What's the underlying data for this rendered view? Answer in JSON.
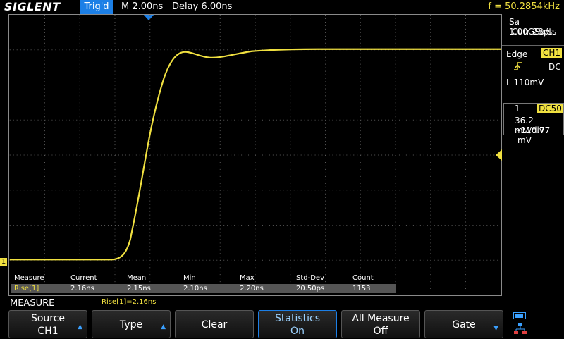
{
  "header": {
    "brand": "SIGLENT",
    "trigger_status": "Trig'd",
    "timebase": "M 2.00ns",
    "delay": "Delay 6.00ns",
    "frequency": "f = 50.2854kHz"
  },
  "acquisition": {
    "sample_rate": "Sa 1.00GSa/s",
    "current_points": "Curr 28pts"
  },
  "trigger": {
    "type": "Edge",
    "source": "CH1",
    "coupling": "DC",
    "level": "L  110mV"
  },
  "channel": {
    "number": "1",
    "coupling_badge": "DC50",
    "scale": "36.2 mV/div",
    "offset": "-110.77 mV",
    "marker": "1"
  },
  "measure": {
    "headers": [
      "Measure",
      "Current",
      "Mean",
      "Min",
      "Max",
      "Std-Dev",
      "Count"
    ],
    "row": [
      "Rise[1]",
      "2.16ns",
      "2.15ns",
      "2.10ns",
      "2.20ns",
      "20.50ps",
      "1153"
    ],
    "title": "MEASURE",
    "result": "Rise[1]=2.16ns"
  },
  "softkeys": {
    "source": {
      "line1": "Source",
      "line2": "CH1"
    },
    "type": {
      "label": "Type"
    },
    "clear": {
      "label": "Clear"
    },
    "statistics": {
      "line1": "Statistics",
      "line2": "On"
    },
    "all_measure": {
      "line1": "All Measure",
      "line2": "Off"
    },
    "gate": {
      "label": "Gate"
    }
  },
  "colors": {
    "trace": "#f0e040",
    "accent": "#1c7fe6",
    "grid": "#8a8a8a"
  }
}
